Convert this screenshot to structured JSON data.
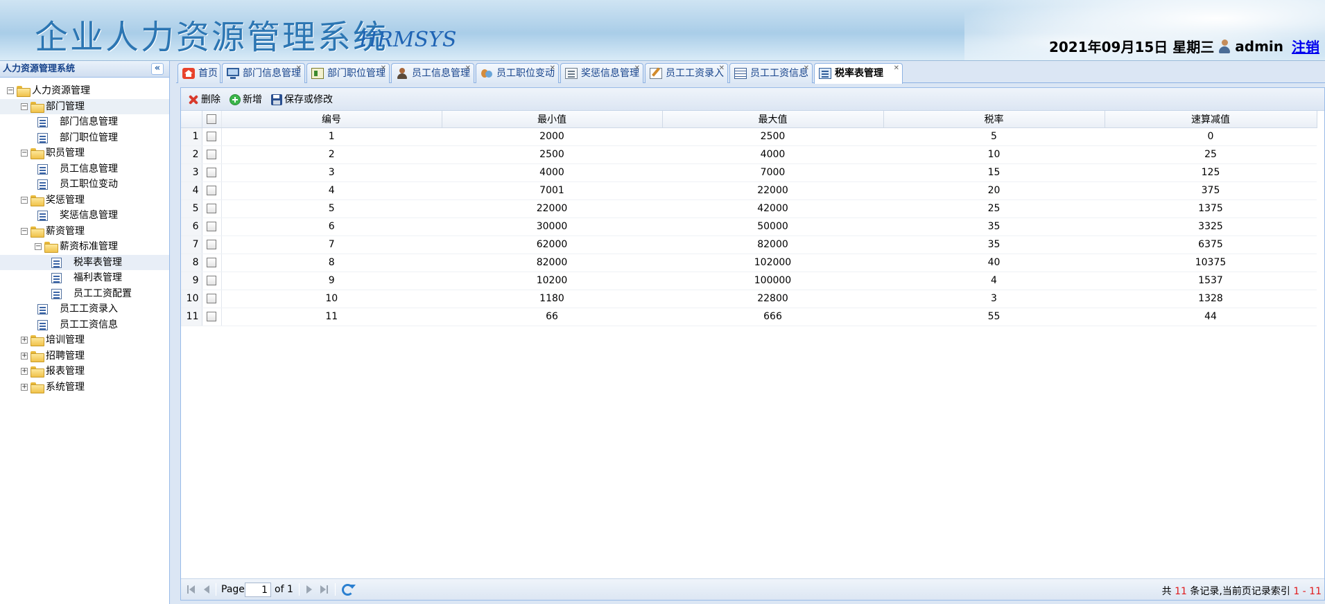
{
  "header": {
    "title": "企业人力资源管理系统",
    "subtitle": "HRMSYS",
    "datetime": "2021年09月15日 星期三",
    "username": "admin",
    "logout": "注销"
  },
  "sidebar": {
    "title": "人力资源管理系统",
    "collapse_glyph": "«",
    "nodes": [
      {
        "label": "人力资源管理",
        "ctl": "−"
      },
      {
        "label": "部门管理",
        "ctl": "−"
      },
      {
        "label": "部门信息管理"
      },
      {
        "label": "部门职位管理"
      },
      {
        "label": "职员管理",
        "ctl": "−"
      },
      {
        "label": "员工信息管理"
      },
      {
        "label": "员工职位变动"
      },
      {
        "label": "奖惩管理",
        "ctl": "−"
      },
      {
        "label": "奖惩信息管理"
      },
      {
        "label": "薪资管理",
        "ctl": "−"
      },
      {
        "label": "薪资标准管理",
        "ctl": "−"
      },
      {
        "label": "税率表管理"
      },
      {
        "label": "福利表管理"
      },
      {
        "label": "员工工资配置"
      },
      {
        "label": "员工工资录入"
      },
      {
        "label": "员工工资信息"
      },
      {
        "label": "培训管理",
        "ctl": "+"
      },
      {
        "label": "招聘管理",
        "ctl": "+"
      },
      {
        "label": "报表管理",
        "ctl": "+"
      },
      {
        "label": "系统管理",
        "ctl": "+"
      }
    ]
  },
  "tabs": [
    {
      "label": "首页",
      "icon": "home-icon"
    },
    {
      "label": "部门信息管理",
      "icon": "monitor-icon"
    },
    {
      "label": "部门职位管理",
      "icon": "card-icon"
    },
    {
      "label": "员工信息管理",
      "icon": "person-icon"
    },
    {
      "label": "员工职位变动",
      "icon": "people-icon"
    },
    {
      "label": "奖惩信息管理",
      "icon": "list-icon"
    },
    {
      "label": "员工工资录入",
      "icon": "edit-icon"
    },
    {
      "label": "员工工资信息",
      "icon": "table-icon"
    },
    {
      "label": "税率表管理",
      "icon": "doclist-icon",
      "active": true
    }
  ],
  "tab_close_glyph": "✕",
  "toolbar": {
    "delete_label": "删除",
    "add_label": "新增",
    "save_label": "保存或修改"
  },
  "grid": {
    "columns": [
      "编号",
      "最小值",
      "最大值",
      "税率",
      "速算减值"
    ],
    "rows": [
      [
        "1",
        "1",
        "2000",
        "2500",
        "5",
        "0"
      ],
      [
        "2",
        "2",
        "2500",
        "4000",
        "10",
        "25"
      ],
      [
        "3",
        "3",
        "4000",
        "7000",
        "15",
        "125"
      ],
      [
        "4",
        "4",
        "7001",
        "22000",
        "20",
        "375"
      ],
      [
        "5",
        "5",
        "22000",
        "42000",
        "25",
        "1375"
      ],
      [
        "6",
        "6",
        "30000",
        "50000",
        "35",
        "3325"
      ],
      [
        "7",
        "7",
        "62000",
        "82000",
        "35",
        "6375"
      ],
      [
        "8",
        "8",
        "82000",
        "102000",
        "40",
        "10375"
      ],
      [
        "9",
        "9",
        "10200",
        "100000",
        "4",
        "1537"
      ],
      [
        "10",
        "10",
        "1180",
        "22800",
        "3",
        "1328"
      ],
      [
        "11",
        "11",
        "66",
        "666",
        "55",
        "44"
      ]
    ]
  },
  "pager": {
    "page_label": "Page",
    "page_value": "1",
    "of_label": "of 1",
    "info_prefix": "共 ",
    "info_count": "11",
    "info_mid": " 条记录,当前页记录索引 ",
    "info_range": "1 - 11"
  }
}
